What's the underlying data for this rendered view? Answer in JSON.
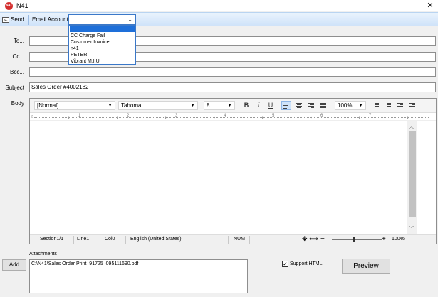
{
  "window": {
    "app_icon_text": "N41",
    "title": "N41",
    "close_glyph": "✕"
  },
  "toolbar": {
    "send_label": "Send",
    "email_account_label": "Email Account",
    "account_selected": "",
    "account_options": [
      "CC Charge Fail",
      "Customer Invoice",
      "n41",
      "PETER",
      "Vibrant M.I.U"
    ]
  },
  "form": {
    "to_label": "To...",
    "cc_label": "Cc...",
    "bcc_label": "Bcc...",
    "subject_label": "Subject",
    "subject_value": "Sales Order #4002182",
    "body_label": "Body"
  },
  "editor": {
    "style_value": "[Normal]",
    "font_value": "Tahoma",
    "size_value": "8",
    "bold": "B",
    "italic": "I",
    "underline": "U",
    "zoom_value": "100%",
    "ruler_labels": [
      "1",
      "2",
      "3",
      "4",
      "5",
      "6",
      "7"
    ],
    "status": {
      "section": "Section1/1",
      "line": "Line1",
      "col": "Col0",
      "language": "English (United States)",
      "num": "NUM",
      "zoom_percent": "100%"
    }
  },
  "attachments": {
    "label": "Attachments",
    "add_label": "Add",
    "files": [
      "C:\\N41\\Sales Order Print_91725_095111690.pdf"
    ],
    "support_html_label": "Support HTML",
    "support_html_checked": true,
    "preview_label": "Preview"
  },
  "colors": {
    "accent": "#1e6fd9",
    "toolbar": "#cfe3f9"
  }
}
